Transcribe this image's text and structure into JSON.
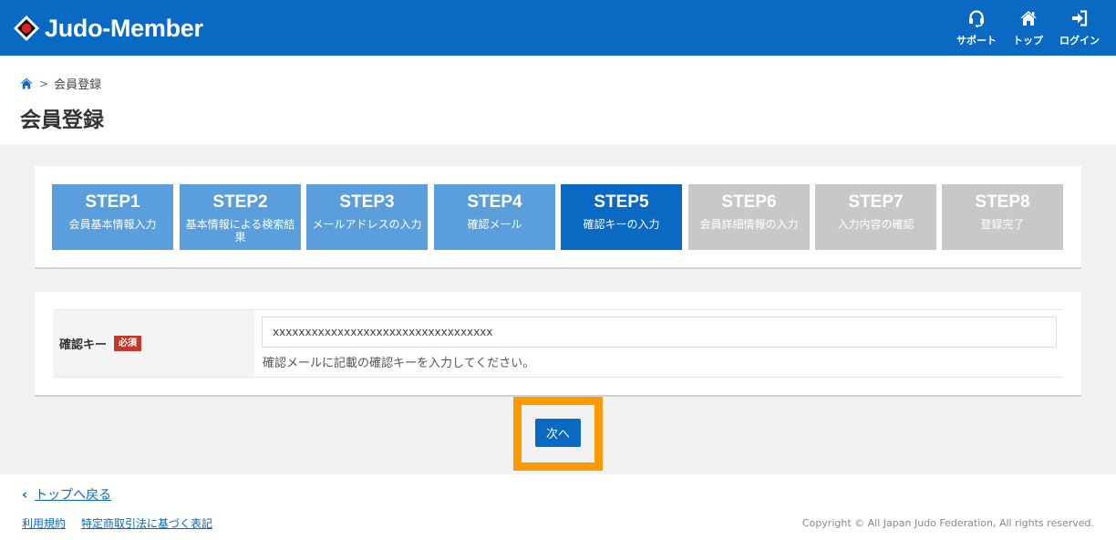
{
  "header": {
    "logo_text": "Judo-Member",
    "nav": [
      {
        "label": "サポート",
        "icon": "headset-icon"
      },
      {
        "label": "トップ",
        "icon": "home-icon"
      },
      {
        "label": "ログイン",
        "icon": "login-icon"
      }
    ]
  },
  "breadcrumb": {
    "home_icon": "home-icon",
    "separator": ">",
    "current": "会員登録"
  },
  "page_title": "会員登録",
  "steps": [
    {
      "label": "STEP1",
      "desc": "会員基本情報入力",
      "state": "done"
    },
    {
      "label": "STEP2",
      "desc": "基本情報による検索結果",
      "state": "done"
    },
    {
      "label": "STEP3",
      "desc": "メールアドレスの入力",
      "state": "done"
    },
    {
      "label": "STEP4",
      "desc": "確認メール",
      "state": "done"
    },
    {
      "label": "STEP5",
      "desc": "確認キーの入力",
      "state": "current"
    },
    {
      "label": "STEP6",
      "desc": "会員詳細情報の入力",
      "state": "todo"
    },
    {
      "label": "STEP7",
      "desc": "入力内容の確認",
      "state": "todo"
    },
    {
      "label": "STEP8",
      "desc": "登録完了",
      "state": "todo"
    }
  ],
  "form": {
    "label": "確認キー",
    "required_badge": "必須",
    "value": "xxxxxxxxxxxxxxxxxxxxxxxxxxxxxxxxxx",
    "hint": "確認メールに記載の確認キーを入力してください。"
  },
  "next_button": "次へ",
  "footer": {
    "back_chevron": "‹",
    "back_link": "トップへ戻る",
    "links": [
      "利用規約",
      "特定商取引法に基づく表記"
    ],
    "copyright": "Copyright © All Japan Judo Federation, All rights reserved."
  },
  "colors": {
    "primary": "#0a69c3",
    "step_done": "#5a9fdc",
    "step_todo": "#c8c8c8",
    "required": "#c0392b",
    "highlight": "#fd9a00"
  }
}
